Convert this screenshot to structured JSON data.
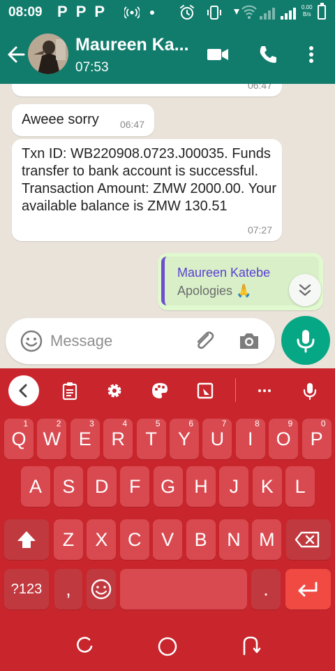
{
  "status_bar": {
    "time": "08:09",
    "p_icons": [
      "P",
      "P",
      "P"
    ],
    "speed_value": "0.00",
    "speed_unit": "B/s"
  },
  "header": {
    "contact_name": "Maureen Ka...",
    "subtitle": "07:53"
  },
  "messages": [
    {
      "text": "…",
      "time": "06:47"
    },
    {
      "text": "Aweee sorry",
      "time": "06:47"
    },
    {
      "text": "Txn ID: WB220908.0723.J00035. Funds transfer to bank account is successful. Transaction Amount: ZMW 2000.00. Your available balance is ZMW 130.51",
      "time": "07:27"
    }
  ],
  "reply_draft": {
    "quoted_name": "Maureen Katebe",
    "quoted_text": "Apologies 🙏"
  },
  "composer": {
    "placeholder": "Message"
  },
  "keyboard": {
    "row1": [
      {
        "key": "Q",
        "hint": "1"
      },
      {
        "key": "W",
        "hint": "2"
      },
      {
        "key": "E",
        "hint": "3"
      },
      {
        "key": "R",
        "hint": "4"
      },
      {
        "key": "T",
        "hint": "5"
      },
      {
        "key": "Y",
        "hint": "6"
      },
      {
        "key": "U",
        "hint": "7"
      },
      {
        "key": "I",
        "hint": "8"
      },
      {
        "key": "O",
        "hint": "9"
      },
      {
        "key": "P",
        "hint": "0"
      }
    ],
    "row2": [
      "A",
      "S",
      "D",
      "F",
      "G",
      "H",
      "J",
      "K",
      "L"
    ],
    "row3": [
      "Z",
      "X",
      "C",
      "V",
      "B",
      "N",
      "M"
    ],
    "symbols_label": "?123",
    "comma_label": ",",
    "period_label": "."
  },
  "colors": {
    "header_bg": "#117c6c",
    "keyboard_bg": "#c8252c",
    "key_bg": "#d94a50",
    "mic_bg": "#06a784",
    "outgoing_bubble": "#e1f9cf",
    "quote_accent": "#6c4fd0"
  },
  "icons": {
    "status": [
      "alarm-icon",
      "vibrate-icon",
      "wifi-icon",
      "signal-icon",
      "battery-icon"
    ],
    "header": [
      "back-arrow-icon",
      "video-call-icon",
      "phone-icon",
      "more-vert-icon"
    ],
    "composer": [
      "emoji-icon",
      "attach-icon",
      "camera-icon",
      "mic-icon"
    ],
    "keyboard_toolbar": [
      "chevron-left-icon",
      "clipboard-icon",
      "settings-icon",
      "palette-icon",
      "resize-icon",
      "more-horiz-icon",
      "mic-icon"
    ],
    "navigation": [
      "recents-icon",
      "home-icon",
      "back-icon"
    ]
  }
}
